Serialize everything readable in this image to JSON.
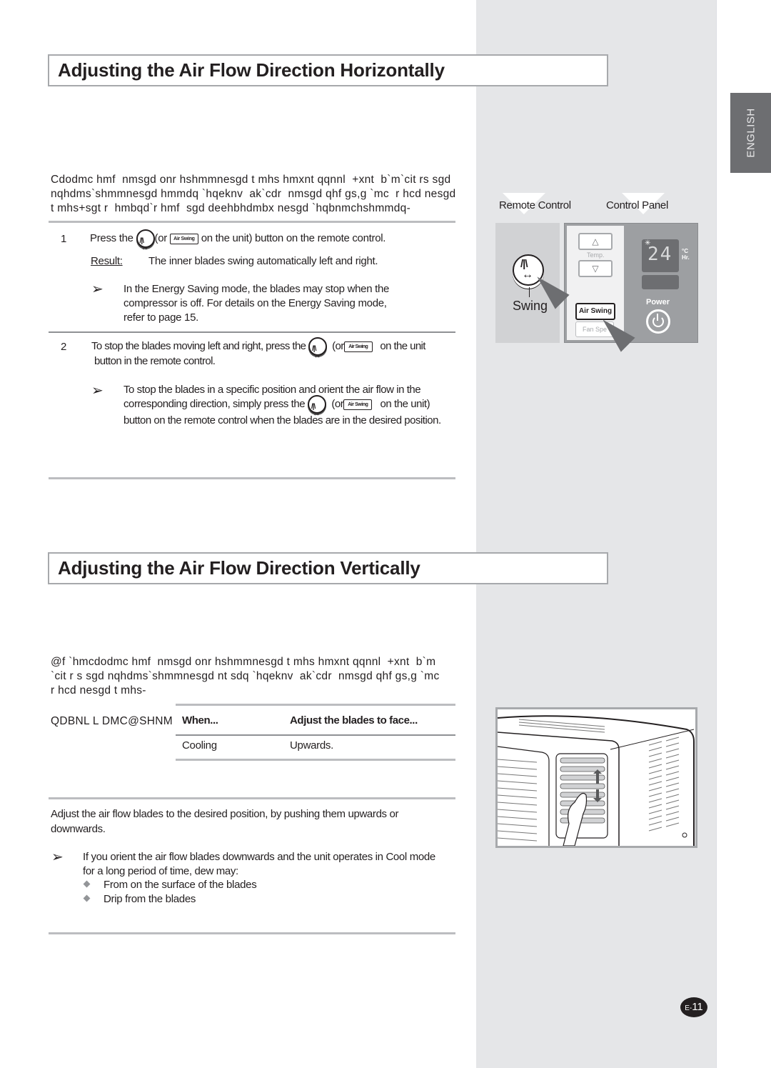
{
  "side_tab": {
    "label": "ENGLISH"
  },
  "section1": {
    "title": "Adjusting the Air Flow Direction Horizontally",
    "intro_lines": [
      "Cdodmc hmf  nmsgd onr hshmmnesgd t mhs hmxnt qqnnl  +xnt  b`m`cit rs sgd",
      "nqhdms`shmmnesgd hmmdq `hqeknv  ak`cdr  nmsgd qhf gs,g `mc  r hcd nesgd",
      "t mhs+sgt r  hmbqd`r hmf  sgd deehbhdmbx nesgd `hqbnmchshmmdq-"
    ],
    "step1": {
      "number": "1",
      "text_before": "Press the",
      "text_or": "(or",
      "text_after": "on the unit) button on the remote control.",
      "result_label": "Result:",
      "result_text": "The inner blades swing automatically left and right.",
      "note_lines": [
        "In the Energy Saving mode, the blades may stop when the",
        "compressor is off. For details on the Energy Saving mode,",
        "refer to page 15."
      ]
    },
    "step2": {
      "number": "2",
      "text_before": "To stop the blades moving left and right, press the",
      "text_or": "(or",
      "text_after": "on the unit",
      "text_line2": "button in the remote control.",
      "note_line1": "To stop the blades in a specific position and orient the air flow in the",
      "note_line2_before": "corresponding direction, simply press the",
      "note_line2_or": "(or",
      "note_line2_after": "on the  unit)",
      "note_line3": "button on the remote control when the blades are in the desired position."
    },
    "icons": {
      "air_swing_label": "Air Swing"
    }
  },
  "illustration1": {
    "remote_label": "Remote Control",
    "panel_label": "Control Panel",
    "swing_label": "Swing",
    "temp_up": "△",
    "temp_label": "Temp.",
    "temp_down": "▽",
    "air_swing_button": "Air Swing",
    "fan_speed_button": "Fan Spe",
    "display_value": "24",
    "display_snow": "✳",
    "unit_c": "°C",
    "unit_hr": "Hr.",
    "power_label": "Power"
  },
  "section2": {
    "title": "Adjusting the Air Flow Direction Vertically",
    "intro_lines": [
      "@f `hmcdodmc hmf  nmsgd onr hshmmnesgd t mhs hmxnt qqnnl  +xnt  b`m",
      "`cit r s sgd nqhdms`shmmnesgd nt sdq `hqeknv  ak`cdr  nmsgd qhf gs,g `mc",
      "r hcd nesgd t mhs-"
    ],
    "table_side_label": "QDBNL L DMC@SHNM",
    "table": {
      "headers": [
        "When...",
        "Adjust the blades to face..."
      ],
      "rows": [
        [
          "Cooling",
          "Upwards."
        ]
      ]
    },
    "instruction_lines": [
      "Adjust the air flow blades to the desired position, by pushing them upwards or",
      "downwards."
    ],
    "note_lines": [
      "If you orient the air flow blades downwards and the unit operates in Cool mode",
      "for a long period of time, dew may:"
    ],
    "bullets": [
      "From on the surface of the blades",
      "Drip from the blades"
    ]
  },
  "page_number": {
    "prefix": "E-",
    "number": "11"
  }
}
